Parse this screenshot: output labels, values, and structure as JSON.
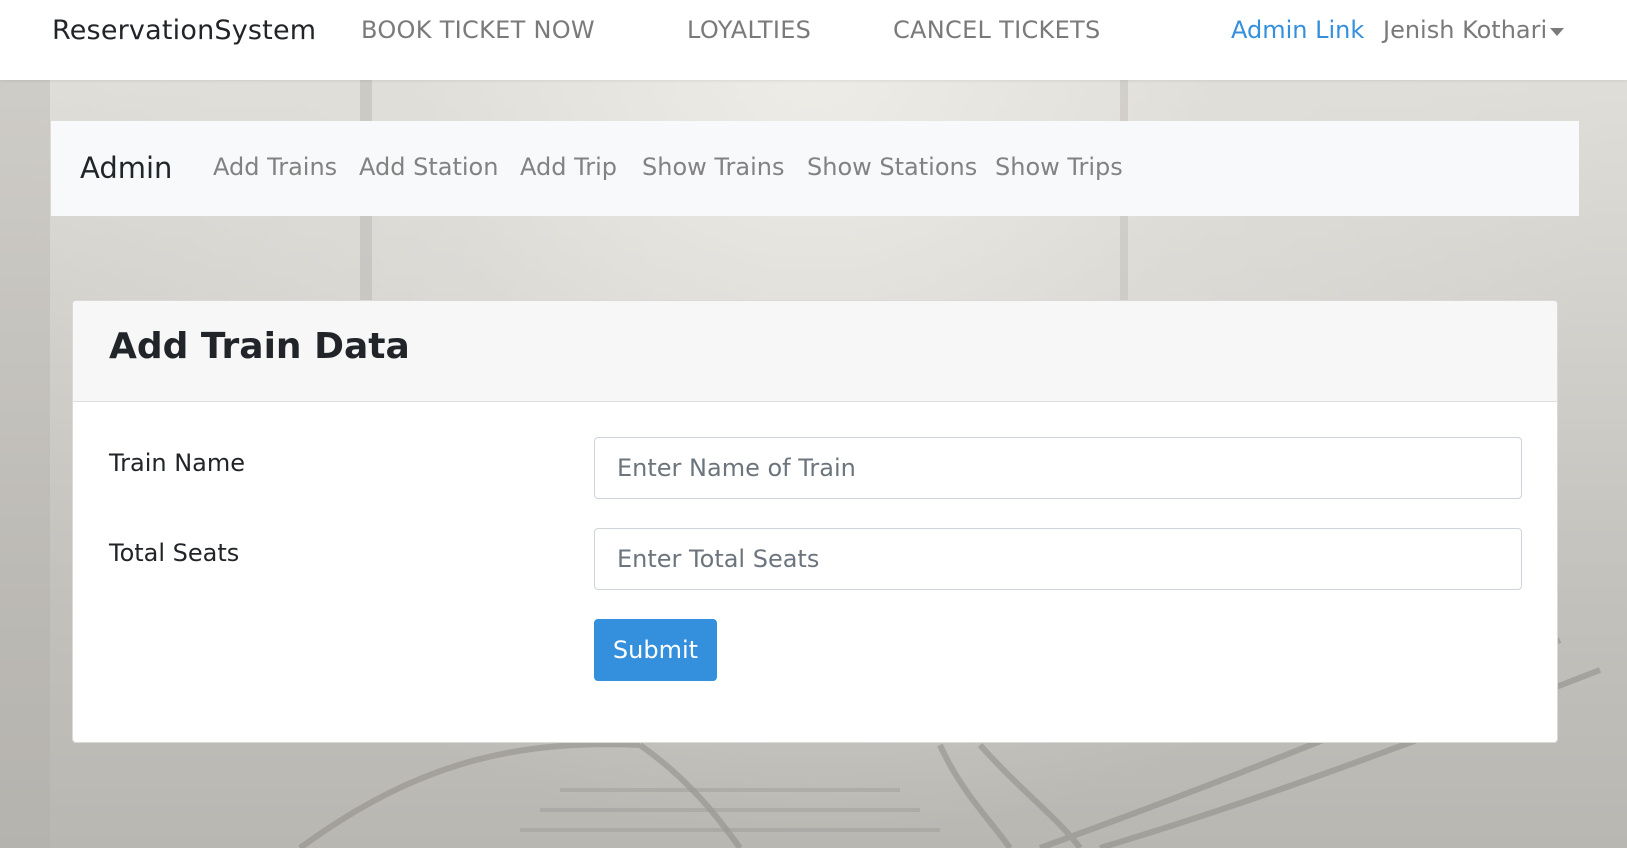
{
  "topnav": {
    "brand": "ReservationSystem",
    "links": [
      "BOOK TICKET NOW",
      "LOYALTIES",
      "CANCEL TICKETS"
    ],
    "admin_link": "Admin Link",
    "user_name": "Jenish Kothari"
  },
  "admin_nav": {
    "title": "Admin",
    "links": [
      "Add Trains",
      "Add Station",
      "Add Trip",
      "Show Trains",
      "Show Stations",
      "Show Trips"
    ]
  },
  "card": {
    "title": "Add Train Data",
    "fields": [
      {
        "label": "Train Name",
        "placeholder": "Enter Name of Train",
        "value": ""
      },
      {
        "label": "Total Seats",
        "placeholder": "Enter Total Seats",
        "value": ""
      }
    ],
    "submit_label": "Submit"
  },
  "colors": {
    "accent": "#3490dc",
    "navbar_bg": "#ffffff",
    "admin_nav_bg": "#f8f9fa",
    "card_header_bg": "#f7f7f7"
  }
}
